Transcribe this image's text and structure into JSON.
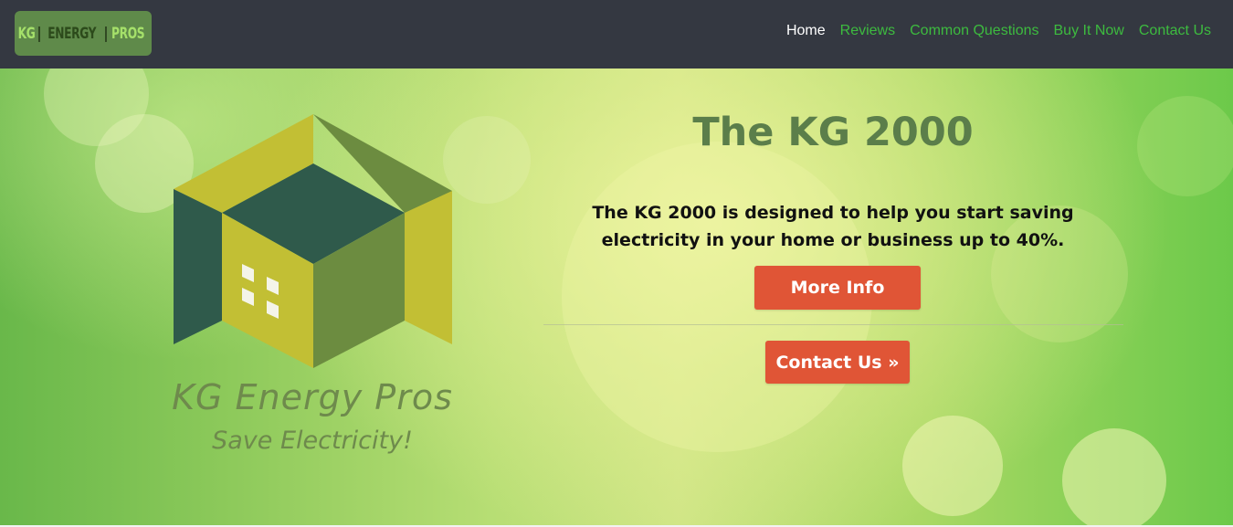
{
  "brand": {
    "part1": "KG",
    "separator": "|",
    "part2": "ENERGY",
    "part3": "PROS"
  },
  "nav": {
    "items": [
      {
        "label": "Home",
        "active": true
      },
      {
        "label": "Reviews",
        "active": false
      },
      {
        "label": "Common Questions",
        "active": false
      },
      {
        "label": "Buy It Now",
        "active": false
      },
      {
        "label": "Contact Us",
        "active": false
      }
    ]
  },
  "logo": {
    "name": "KG Energy Pros",
    "tagline": "Save Electricity!"
  },
  "hero": {
    "title": "The KG 2000",
    "description": "The KG 2000 is designed to help you start saving electricity in your home or business up to 40%.",
    "more_info_label": "More Info",
    "contact_label": "Contact Us »"
  },
  "colors": {
    "navbar": "#343841",
    "nav_link": "#3dbb3f",
    "nav_active": "#ffffff",
    "button": "#e05536",
    "title": "#5b7e4a"
  }
}
